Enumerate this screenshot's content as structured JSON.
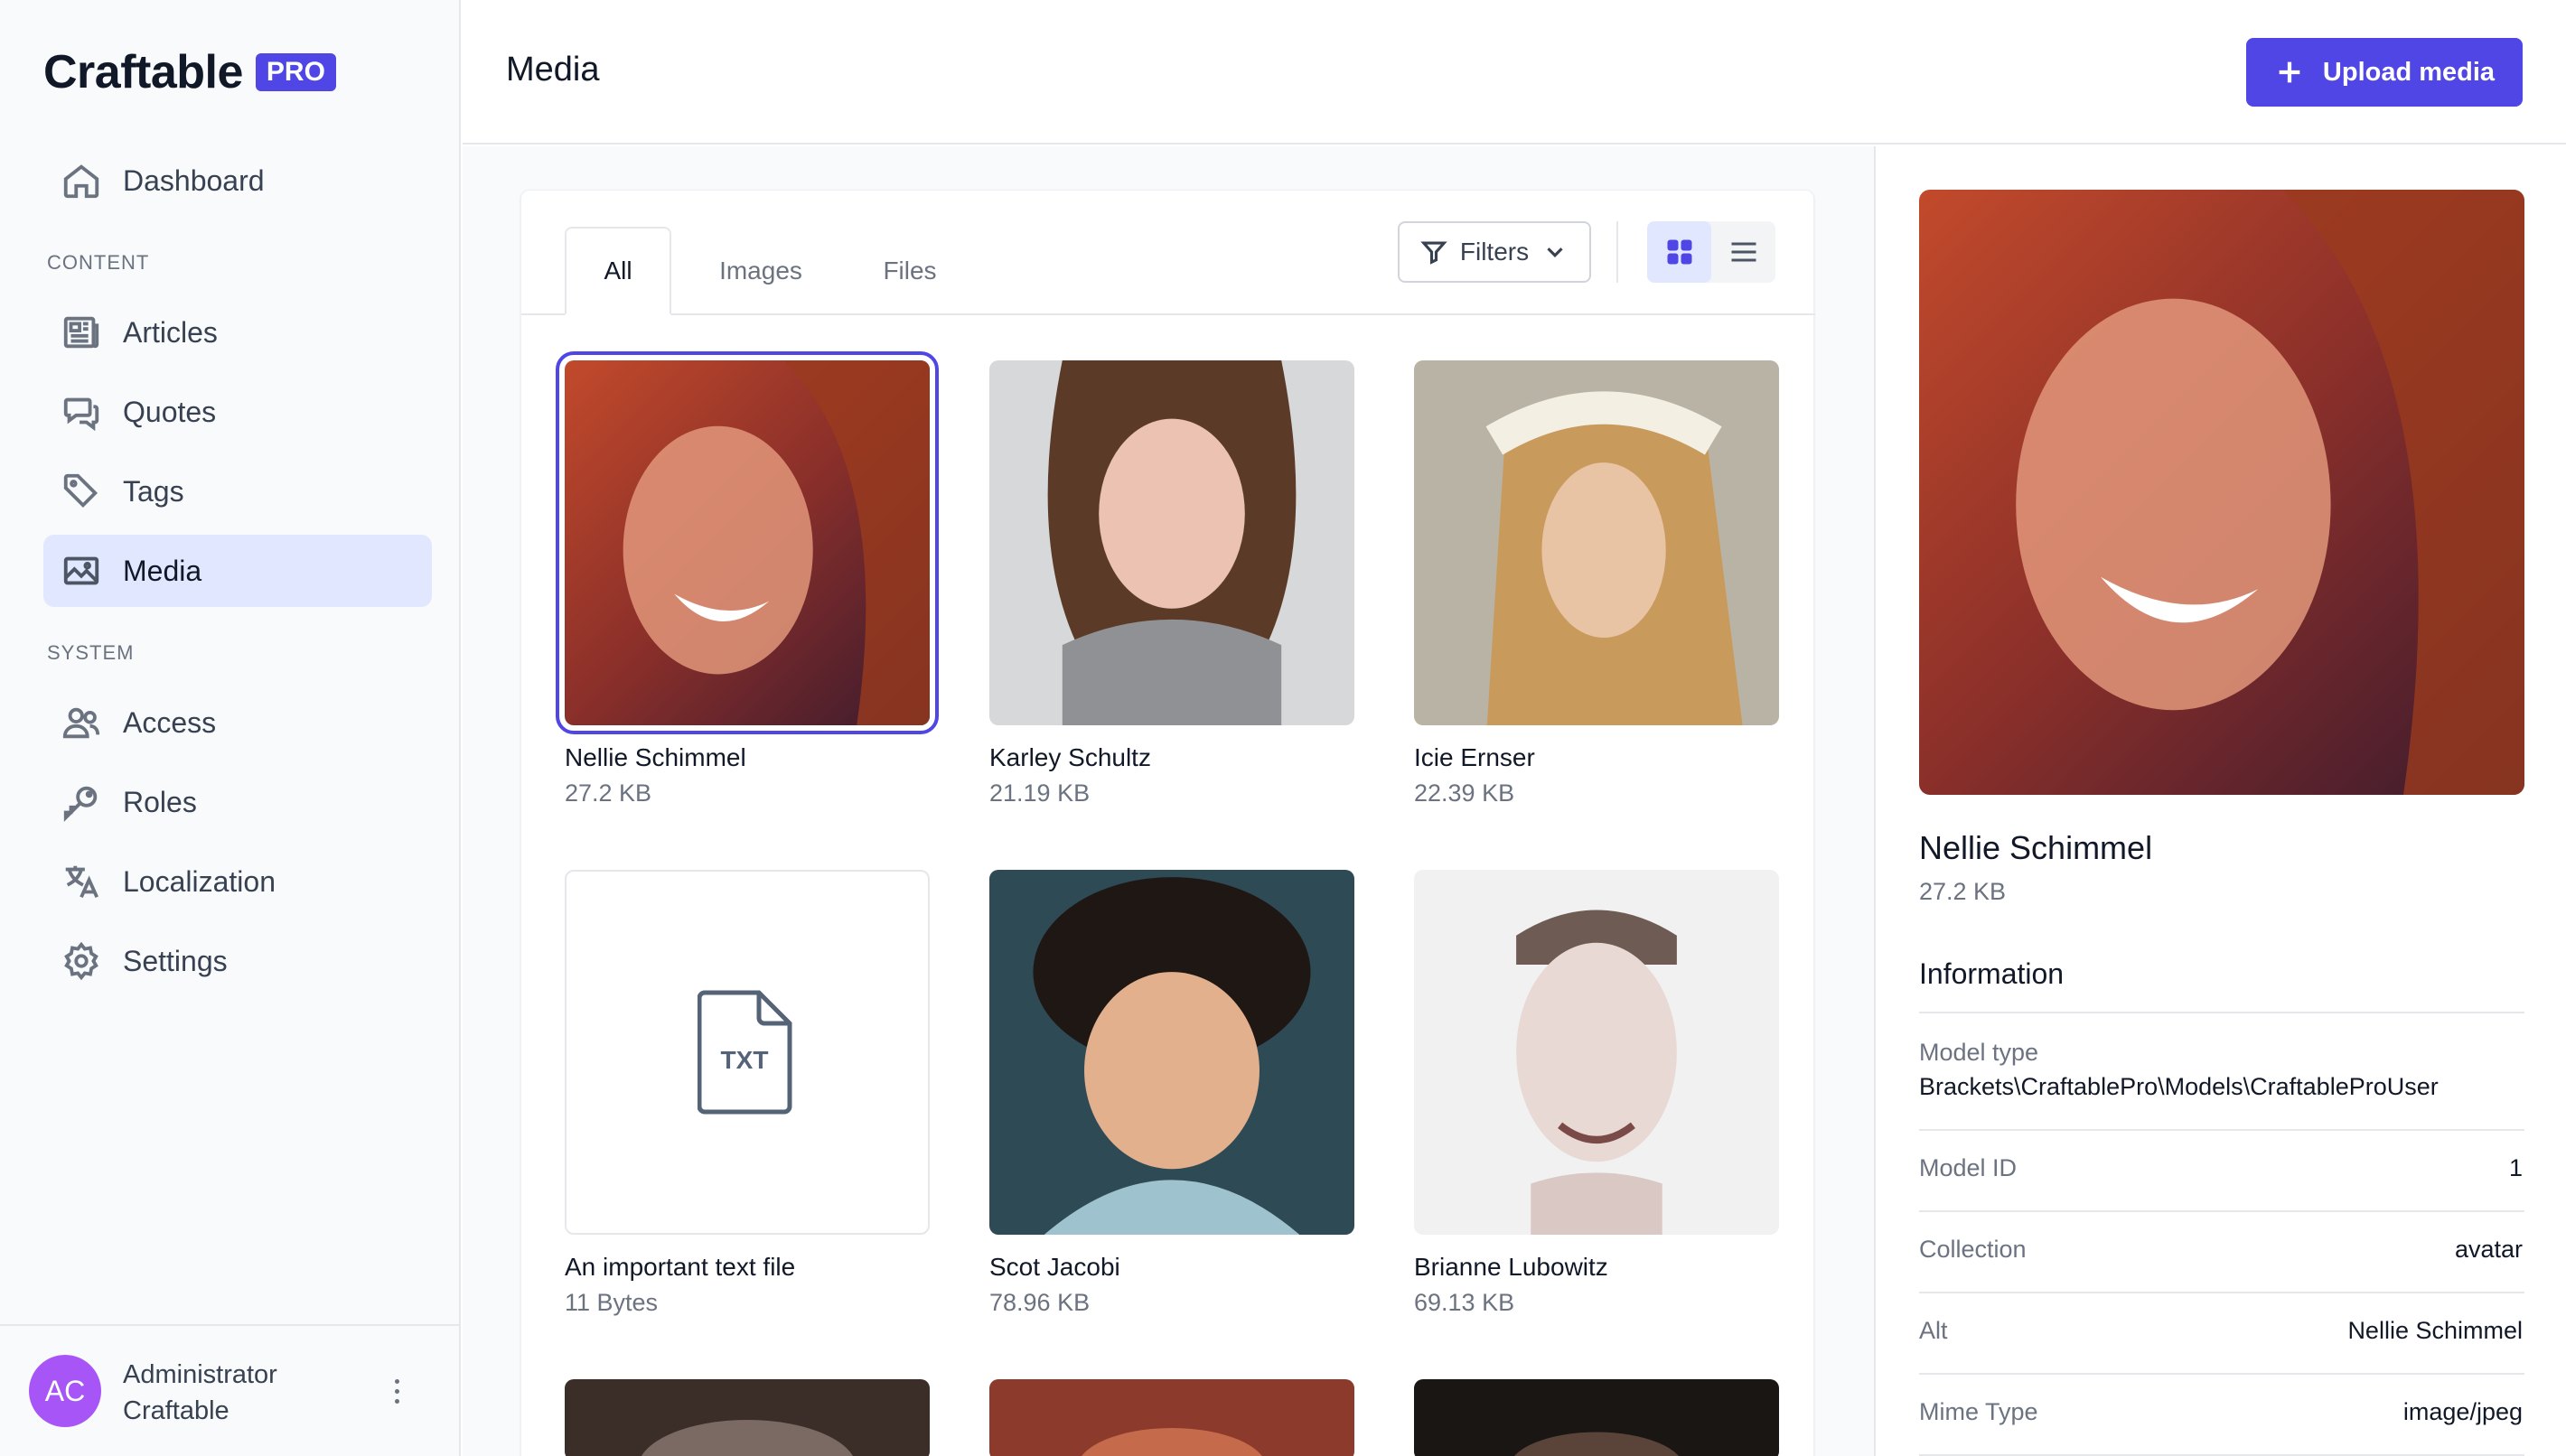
{
  "brand": {
    "name": "Craftable",
    "badge": "PRO"
  },
  "sidebar": {
    "items": [
      {
        "label": "Dashboard",
        "icon": "home-icon"
      },
      {
        "label": "Articles",
        "icon": "newspaper-icon"
      },
      {
        "label": "Quotes",
        "icon": "chat-icon"
      },
      {
        "label": "Tags",
        "icon": "tag-icon"
      },
      {
        "label": "Media",
        "icon": "image-icon",
        "active": true
      },
      {
        "label": "Access",
        "icon": "users-icon"
      },
      {
        "label": "Roles",
        "icon": "key-icon"
      },
      {
        "label": "Localization",
        "icon": "translate-icon"
      },
      {
        "label": "Settings",
        "icon": "gear-icon"
      }
    ],
    "sections": {
      "content": "CONTENT",
      "system": "SYSTEM"
    }
  },
  "user": {
    "initials": "AC",
    "first": "Administrator",
    "last": "Craftable"
  },
  "header": {
    "title": "Media",
    "upload_label": "Upload media"
  },
  "tabs": [
    {
      "label": "All",
      "active": true
    },
    {
      "label": "Images"
    },
    {
      "label": "Files"
    }
  ],
  "toolbar": {
    "filters_label": "Filters",
    "view": "grid"
  },
  "media": [
    {
      "name": "Nellie Schimmel",
      "size": "27.2 KB",
      "kind": "image",
      "selected": true
    },
    {
      "name": "Karley Schultz",
      "size": "21.19 KB",
      "kind": "image"
    },
    {
      "name": "Icie Ernser",
      "size": "22.39 KB",
      "kind": "image"
    },
    {
      "name": "An important text file",
      "size": "11 Bytes",
      "kind": "file",
      "ext": "TXT"
    },
    {
      "name": "Scot Jacobi",
      "size": "78.96 KB",
      "kind": "image"
    },
    {
      "name": "Brianne Lubowitz",
      "size": "69.13 KB",
      "kind": "image"
    }
  ],
  "detail": {
    "name": "Nellie Schimmel",
    "size": "27.2 KB",
    "info_title": "Information",
    "model_type_label": "Model type",
    "model_type": "Brackets\\CraftablePro\\Models\\CraftableProUser",
    "model_id_label": "Model ID",
    "model_id": "1",
    "collection_label": "Collection",
    "collection": "avatar",
    "alt_label": "Alt",
    "alt": "Nellie Schimmel",
    "mime_label": "Mime Type",
    "mime": "image/jpeg"
  },
  "colors": {
    "accent": "#4f46e5",
    "avatar": "#a855f7",
    "active_bg": "#e0e7ff"
  }
}
